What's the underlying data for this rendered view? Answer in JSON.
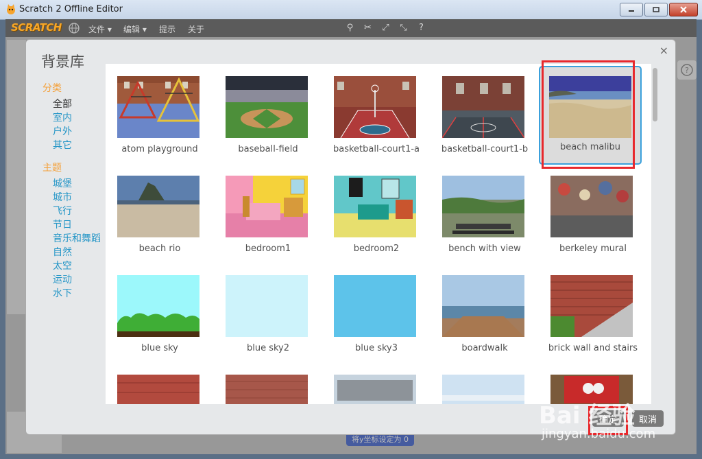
{
  "window": {
    "title": "Scratch 2 Offline Editor"
  },
  "menubar": {
    "logo": "SCRATCH",
    "file": "文件 ▾",
    "edit": "编辑 ▾",
    "tips": "提示",
    "about": "关于"
  },
  "dialog": {
    "title": "背景库",
    "close": "×",
    "category_heading": "分类",
    "categories": [
      "全部",
      "室内",
      "户外",
      "其它"
    ],
    "theme_heading": "主题",
    "themes": [
      "城堡",
      "城市",
      "飞行",
      "节日",
      "音乐和舞蹈",
      "自然",
      "太空",
      "运动",
      "水下"
    ],
    "ok_label": "确定",
    "cancel_label": "取消",
    "backdrops": [
      "atom playground",
      "baseball-field",
      "basketball-court1-a",
      "basketball-court1-b",
      "beach malibu",
      "beach rio",
      "bedroom1",
      "bedroom2",
      "bench with view",
      "berkeley mural",
      "blue sky",
      "blue sky2",
      "blue sky3",
      "boardwalk",
      "brick wall and stairs",
      "",
      "",
      "",
      "",
      ""
    ],
    "selected": "beach malibu"
  },
  "background": {
    "block_peek": "将y坐标设定为 0"
  },
  "watermark": {
    "line1": "Bai 经验",
    "line2": "jingyan.baidu.com"
  }
}
